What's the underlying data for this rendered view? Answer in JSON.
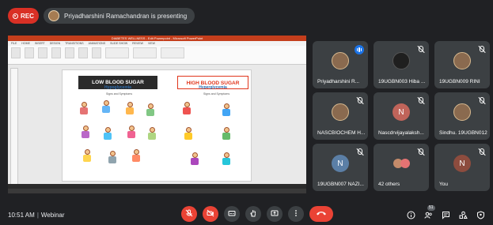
{
  "rec_label": "REC",
  "presenting_text": "Priyadharshini Ramachandran is presenting",
  "slide": {
    "window_title": "DIABETES WELLNESS - Edit Powerpoint - Microsoft PowerPoint",
    "tabs": [
      "FILE",
      "HOME",
      "INSERT",
      "DESIGN",
      "TRANSITIONS",
      "ANIMATIONS",
      "SLIDE SHOW",
      "REVIEW",
      "VIEW"
    ],
    "low_title": "LOW BLOOD SUGAR",
    "low_sub": "Hypoglycemia",
    "high_title": "HIGH BLOOD SUGAR",
    "high_sub": "Hyperglycemia",
    "signs_label": "Signs and Symptoms"
  },
  "tiles": [
    {
      "name": "Priyadharshini R...",
      "avatar": "photo",
      "speaking": true
    },
    {
      "name": "19UGBN003 Hiba ...",
      "avatar": "photo-dark",
      "speaking": false
    },
    {
      "name": "19UGBN009 RINI",
      "avatar": "photo",
      "speaking": false
    },
    {
      "name": "NASCBIOCHEM H...",
      "avatar": "photo",
      "speaking": false
    },
    {
      "name": "Nascdrvijayalaksh...",
      "avatar": "N",
      "avatar_color": "#c0645a",
      "speaking": false
    },
    {
      "name": "Sindhu. 19UGBN012",
      "avatar": "photo",
      "speaking": false
    },
    {
      "name": "19UGBN007 NAZI...",
      "avatar": "N",
      "avatar_color": "#5b7fa6",
      "speaking": false
    },
    {
      "name": "42 others",
      "avatar": "group",
      "speaking": false
    },
    {
      "name": "You",
      "avatar": "N",
      "avatar_color": "#8d4c3e",
      "speaking": false
    }
  ],
  "bottom": {
    "time": "10:51 AM",
    "title": "Webinar",
    "participants_badge": "51"
  },
  "icons": {
    "mic": "mic-off-icon",
    "cam": "camera-off-icon",
    "cc": "captions-icon",
    "hand": "raise-hand-icon",
    "present": "present-icon",
    "more": "more-icon",
    "end": "end-call-icon",
    "info": "info-icon",
    "people": "people-icon",
    "chat": "chat-icon",
    "activities": "activities-icon",
    "safety": "safety-icon"
  }
}
